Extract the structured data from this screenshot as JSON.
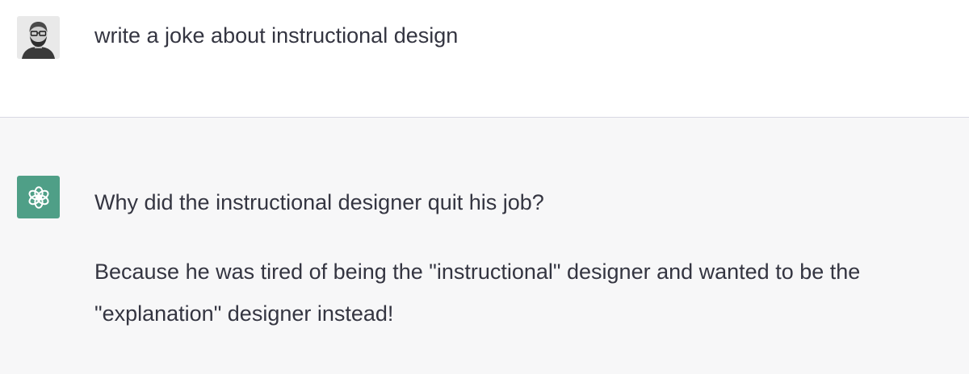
{
  "conversation": {
    "user_message": {
      "avatar": "user-photo-avatar",
      "text": "write a joke about instructional design"
    },
    "assistant_message": {
      "avatar": "openai-logo-icon",
      "paragraphs": [
        "Why did the instructional designer quit his job?",
        "Because he was tired of being the \"instructional\" designer and wanted to be the \"explanation\" designer instead!"
      ]
    }
  },
  "colors": {
    "user_background": "#ffffff",
    "assistant_background": "#f7f7f8",
    "assistant_avatar": "#4f9f87",
    "text": "#343541",
    "divider": "#d9d9e3"
  }
}
